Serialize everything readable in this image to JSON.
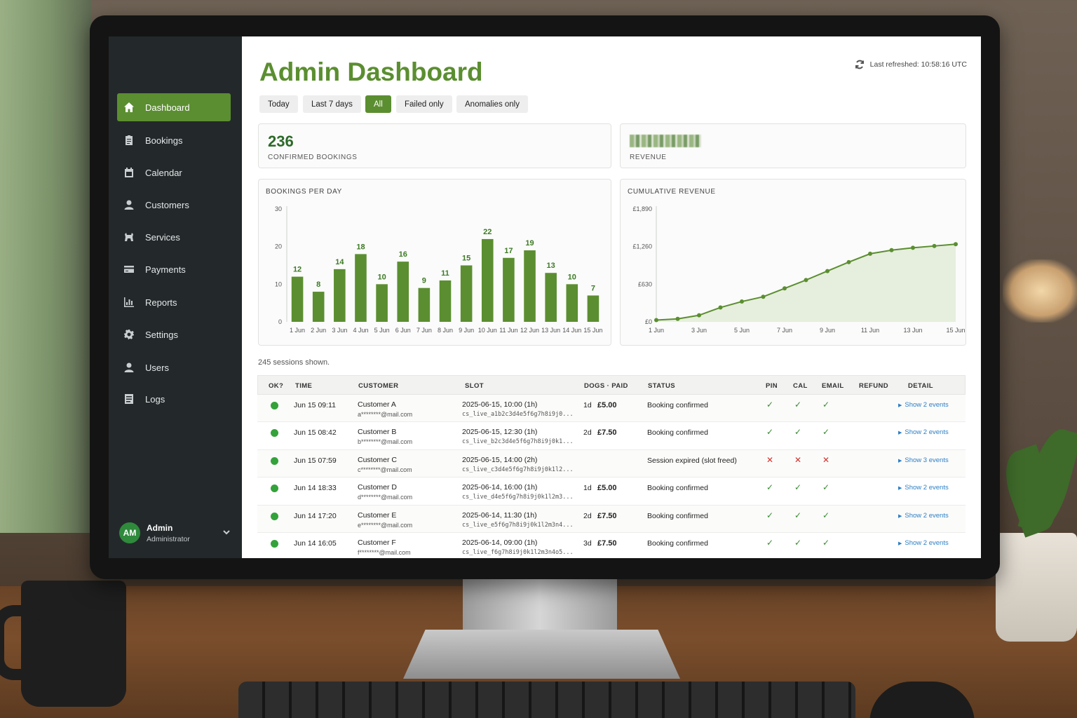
{
  "sidebar": {
    "items": [
      {
        "label": "Dashboard",
        "icon": "home-icon",
        "active": true
      },
      {
        "label": "Bookings",
        "icon": "clipboard-icon"
      },
      {
        "label": "Calendar",
        "icon": "calendar-icon"
      },
      {
        "label": "Customers",
        "icon": "person-icon"
      },
      {
        "label": "Services",
        "icon": "dog-icon"
      },
      {
        "label": "Payments",
        "icon": "credit-card-icon"
      },
      {
        "label": "Reports",
        "icon": "bar-chart-icon"
      },
      {
        "label": "Settings",
        "icon": "gear-icon"
      },
      {
        "label": "Users",
        "icon": "user-icon"
      },
      {
        "label": "Logs",
        "icon": "document-icon"
      }
    ],
    "user": {
      "initials": "AM",
      "name": "Admin",
      "role": "Administrator"
    }
  },
  "header": {
    "title": "Admin Dashboard",
    "refreshed": "Last refreshed: 10:58:16 UTC"
  },
  "filters": [
    {
      "label": "Today",
      "active": false
    },
    {
      "label": "Last 7 days",
      "active": false
    },
    {
      "label": "All",
      "active": true
    },
    {
      "label": "Failed only",
      "active": false
    },
    {
      "label": "Anomalies only",
      "active": false
    }
  ],
  "stats": {
    "bookings": {
      "value": "236",
      "label": "CONFIRMED BOOKINGS"
    },
    "revenue": {
      "value": "£1,260.00",
      "label": "REVENUE"
    }
  },
  "colors": {
    "accent": "#5b8e30",
    "bar": "#5b8e30",
    "line": "#5b8e30",
    "area": "#e6eedd",
    "ok": "#3a8a34",
    "bad": "#d0342c",
    "link": "#2d7fc4"
  },
  "chart_data": [
    {
      "type": "bar",
      "title": "BOOKINGS PER DAY",
      "categories": [
        "1 Jun",
        "2 Jun",
        "3 Jun",
        "4 Jun",
        "5 Jun",
        "6 Jun",
        "7 Jun",
        "8 Jun",
        "9 Jun",
        "10 Jun",
        "11 Jun",
        "12 Jun",
        "13 Jun",
        "14 Jun",
        "15 Jun"
      ],
      "values": [
        12,
        8,
        14,
        18,
        10,
        16,
        9,
        11,
        15,
        22,
        17,
        19,
        13,
        10,
        7
      ],
      "ylim": [
        0,
        30
      ],
      "yticks": [
        "0",
        "10",
        "20",
        "30"
      ],
      "grid": false
    },
    {
      "type": "area",
      "title": "CUMULATIVE REVENUE",
      "x": [
        "1 Jun",
        "2 Jun",
        "3 Jun",
        "4 Jun",
        "5 Jun",
        "6 Jun",
        "7 Jun",
        "8 Jun",
        "9 Jun",
        "10 Jun",
        "11 Jun",
        "12 Jun",
        "13 Jun",
        "14 Jun",
        "15 Jun"
      ],
      "xticks": [
        "1 Jun",
        "3 Jun",
        "5 Jun",
        "7 Jun",
        "9 Jun",
        "11 Jun",
        "13 Jun",
        "15 Jun"
      ],
      "values": [
        30,
        50,
        110,
        240,
        340,
        420,
        560,
        700,
        850,
        1000,
        1140,
        1200,
        1240,
        1270,
        1300
      ],
      "ylim": [
        0,
        1890
      ],
      "yticks": [
        "£0",
        "£630",
        "£1,260",
        "£1,890"
      ],
      "grid": false
    }
  ],
  "table": {
    "note": "245 sessions shown.",
    "columns": [
      "OK?",
      "TIME",
      "CUSTOMER",
      "SLOT",
      "DOGS · PAID",
      "STATUS",
      "PIN",
      "CAL",
      "EMAIL",
      "REFUND",
      "DETAIL"
    ],
    "rows": [
      {
        "time": "Jun 15 09:11",
        "customer": "Customer A",
        "email": "a********@mail.com",
        "slot": "2025-06-15, 10:00 (1h)",
        "session": "cs_live_a1b2c3d4e5f6g7h8i9j0...",
        "dogs": "1d",
        "paid": "£5.00",
        "status": "Booking confirmed",
        "pin": "✓",
        "cal": "✓",
        "mail": "✓",
        "pin_ok": true,
        "cal_ok": true,
        "mail_ok": true,
        "detail": "Show 2 events"
      },
      {
        "time": "Jun 15 08:42",
        "customer": "Customer B",
        "email": "b********@mail.com",
        "slot": "2025-06-15, 12:30 (1h)",
        "session": "cs_live_b2c3d4e5f6g7h8i9j0k1...",
        "dogs": "2d",
        "paid": "£7.50",
        "status": "Booking confirmed",
        "pin": "✓",
        "cal": "✓",
        "mail": "✓",
        "pin_ok": true,
        "cal_ok": true,
        "mail_ok": true,
        "detail": "Show 2 events"
      },
      {
        "time": "Jun 15 07:59",
        "customer": "Customer C",
        "email": "c********@mail.com",
        "slot": "2025-06-15, 14:00 (2h)",
        "session": "cs_live_c3d4e5f6g7h8i9j0k1l2...",
        "dogs": "",
        "paid": "",
        "status": "Session expired (slot freed)",
        "pin": "✕",
        "cal": "✕",
        "mail": "✕",
        "pin_ok": false,
        "cal_ok": false,
        "mail_ok": false,
        "detail": "Show 3 events"
      },
      {
        "time": "Jun 14 18:33",
        "customer": "Customer D",
        "email": "d********@mail.com",
        "slot": "2025-06-14, 16:00 (1h)",
        "session": "cs_live_d4e5f6g7h8i9j0k1l2m3...",
        "dogs": "1d",
        "paid": "£5.00",
        "status": "Booking confirmed",
        "pin": "✓",
        "cal": "✓",
        "mail": "✓",
        "pin_ok": true,
        "cal_ok": true,
        "mail_ok": true,
        "detail": "Show 2 events"
      },
      {
        "time": "Jun 14 17:20",
        "customer": "Customer E",
        "email": "e********@mail.com",
        "slot": "2025-06-14, 11:30 (1h)",
        "session": "cs_live_e5f6g7h8i9j0k1l2m3n4...",
        "dogs": "2d",
        "paid": "£7.50",
        "status": "Booking confirmed",
        "pin": "✓",
        "cal": "✓",
        "mail": "✓",
        "pin_ok": true,
        "cal_ok": true,
        "mail_ok": true,
        "detail": "Show 2 events"
      },
      {
        "time": "Jun 14 16:05",
        "customer": "Customer F",
        "email": "f********@mail.com",
        "slot": "2025-06-14, 09:00 (1h)",
        "session": "cs_live_f6g7h8i9j0k1l2m3n4o5...",
        "dogs": "3d",
        "paid": "£7.50",
        "status": "Booking confirmed",
        "pin": "✓",
        "cal": "✓",
        "mail": "✓",
        "pin_ok": true,
        "cal_ok": true,
        "mail_ok": true,
        "detail": "Show 2 events"
      }
    ]
  }
}
